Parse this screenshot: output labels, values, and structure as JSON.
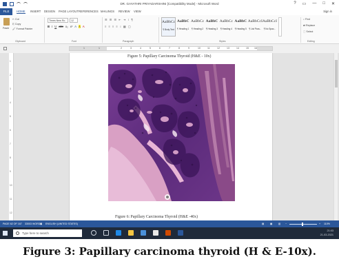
{
  "window": {
    "title": "DR. GAYATHRI PRIYADARSHINI [Compatibility Mode] - Microsoft Word",
    "controls": [
      "?",
      "▭",
      "—",
      "□",
      "✕"
    ],
    "signin": "Sign in"
  },
  "tabs": [
    "FILE",
    "HOME",
    "INSERT",
    "DESIGN",
    "PAGE LAYOUT",
    "REFERENCES",
    "MAILINGS",
    "REVIEW",
    "VIEW"
  ],
  "ribbon": {
    "clipboard": {
      "paste": "Paste",
      "cut": "Cut",
      "copy": "Copy",
      "format_painter": "Format Painter",
      "label": "Clipboard"
    },
    "font": {
      "name": "Times New Ro",
      "size": "12",
      "label": "Font",
      "buttons": [
        "B",
        "I",
        "U",
        "abc",
        "x₂",
        "x²",
        "A",
        "A",
        "A"
      ]
    },
    "paragraph": {
      "label": "Paragraph",
      "row1": [
        "☰",
        "☰",
        "☰",
        "⇤",
        "⇥",
        "↕",
        "¶"
      ],
      "row2": [
        "≡",
        "≡",
        "≡",
        "≡",
        "↕",
        "▦",
        "▢"
      ]
    },
    "styles": {
      "label": "Styles",
      "items": [
        {
          "sample": "AaBbCc",
          "name": "¶ Body Text"
        },
        {
          "sample": "AaBbC",
          "name": "¶ Heading 1"
        },
        {
          "sample": "AaBbCc",
          "name": "¶ Heading 2"
        },
        {
          "sample": "AaBbC",
          "name": "¶ Heading 3"
        },
        {
          "sample": "AaBbCc",
          "name": "¶ Heading 4"
        },
        {
          "sample": "AaBbC",
          "name": "¶ Heading 5"
        },
        {
          "sample": "AaBbCcI",
          "name": "¶ List Para..."
        },
        {
          "sample": "AaBbCcI",
          "name": "¶ No Spac..."
        }
      ]
    },
    "editing": {
      "find": "Find",
      "replace": "Replace",
      "select": "Select",
      "label": "Editing"
    }
  },
  "ruler": {
    "numbers": [
      "1",
      "1",
      "2",
      "3",
      "4",
      "5",
      "6",
      "7",
      "8",
      "9",
      "10",
      "11",
      "12",
      "13",
      "14",
      "15",
      "16"
    ]
  },
  "vruler": {
    "numbers": [
      "1",
      "2",
      "3",
      "4",
      "5",
      "6",
      "7",
      "8",
      "9",
      "10",
      "11",
      "12"
    ]
  },
  "document": {
    "caption_top": "Figure 5: Papillary Carcinoma Thyroid (H&E - 10x)",
    "caption_bottom": "Figure 6: Papillary Carcinoma Thyroid (H&E -40x)"
  },
  "statusbar": {
    "page": "PAGE 62 OF 167",
    "words": "33003 WORDS",
    "language": "ENGLISH (UNITED STATES)",
    "zoom": "110%"
  },
  "taskbar": {
    "search_placeholder": "Type here to search",
    "time": "21:03",
    "date": "21-03-2021"
  },
  "figure_caption": "Figure 3: Papillary carcinoma thyroid (H & E-10x).",
  "colors": {
    "word_blue": "#2b579a",
    "taskbar": "#1f2a3a",
    "stain_purple": "#5a2a7a",
    "stain_pink": "#d9a0c4"
  }
}
